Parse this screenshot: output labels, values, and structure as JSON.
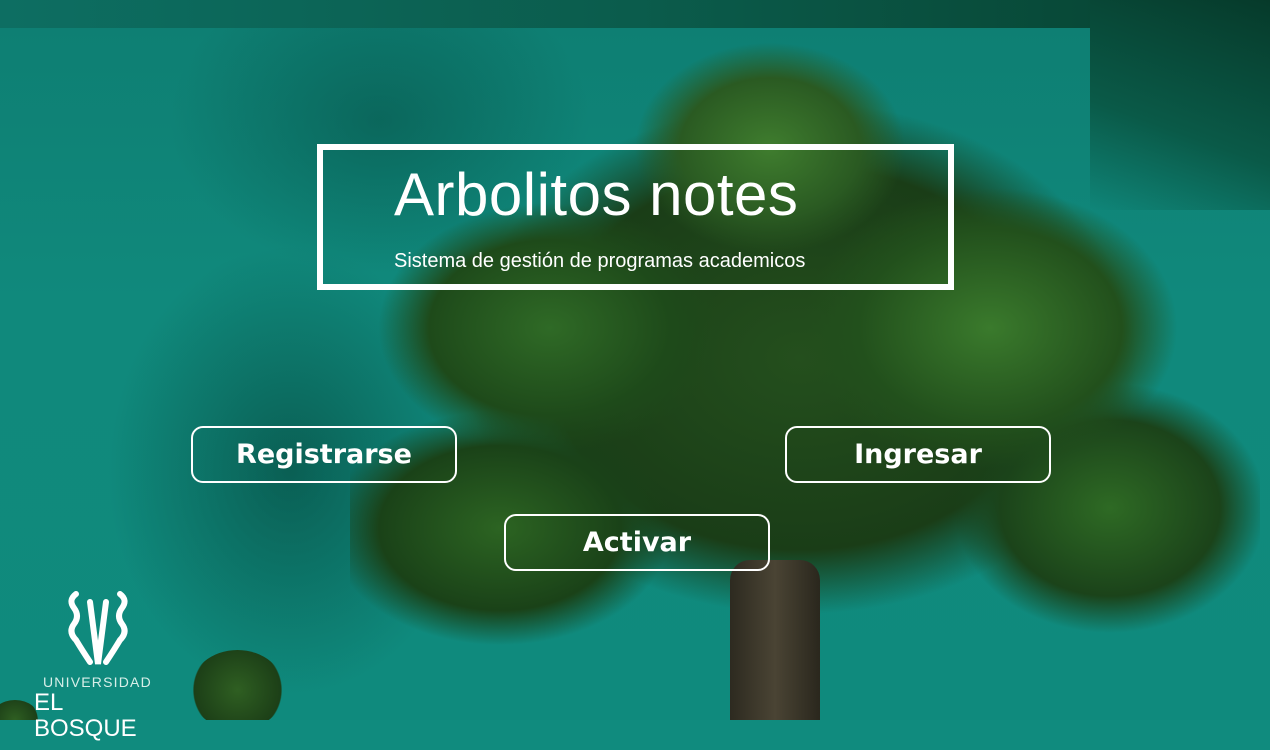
{
  "header": {
    "title": "Arbolitos notes",
    "subtitle": "Sistema de gestión de programas academicos"
  },
  "buttons": {
    "register": "Registrarse",
    "login": "Ingresar",
    "activate": "Activar"
  },
  "logo": {
    "line1": "UNIVERSIDAD",
    "line2": "EL BOSQUE"
  },
  "colors": {
    "background": "#0f877b",
    "foreground": "#ffffff"
  }
}
